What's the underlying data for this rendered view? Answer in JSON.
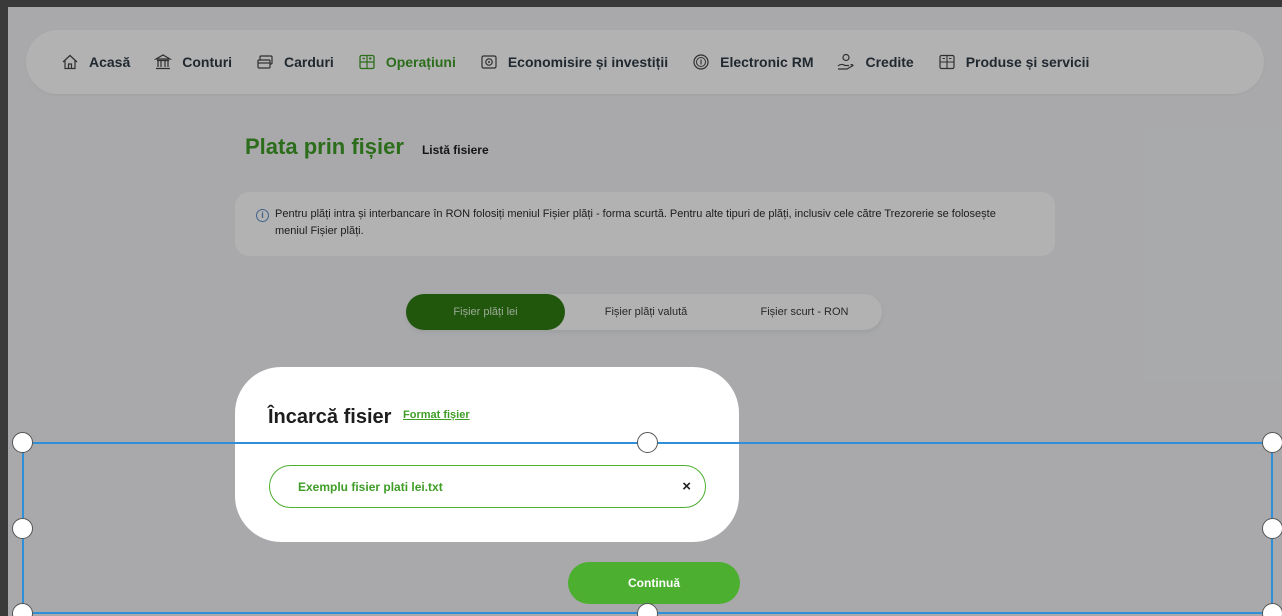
{
  "nav": {
    "items": [
      {
        "label": "Acasă",
        "icon": "home-icon"
      },
      {
        "label": "Conturi",
        "icon": "bank-icon"
      },
      {
        "label": "Carduri",
        "icon": "card-icon"
      },
      {
        "label": "Operațiuni",
        "icon": "operations-icon",
        "active": true
      },
      {
        "label": "Economisire și investiții",
        "icon": "savings-icon"
      },
      {
        "label": "Electronic RM",
        "icon": "coin-icon"
      },
      {
        "label": "Credite",
        "icon": "credit-hand-icon"
      },
      {
        "label": "Produse și servicii",
        "icon": "products-icon"
      }
    ]
  },
  "header": {
    "title": "Plata prin fișier",
    "sub_link": "Listă fisiere"
  },
  "info": {
    "icon": "info-icon",
    "text": "Pentru plăți intra și interbancare în RON folosiți meniul Fișier plăți - forma scurtă. Pentru alte tipuri de plăți, inclusiv cele către Trezorerie se folosește meniul Fișier plăți."
  },
  "tabs": [
    "Fișier plăți lei",
    "Fișier plăți valută",
    "Fișier scurt - RON"
  ],
  "upload": {
    "title": "Încarcă fisier",
    "format_link": "Format fișier",
    "file_name": "Exemplu fisier plati lei.txt",
    "remove_symbol": "×"
  },
  "actions": {
    "continue_label": "Continuă"
  },
  "colors": {
    "accent": "#3f9d27",
    "button": "#4caf30",
    "active_tab": "#2f7d12",
    "selection_border": "#2f8fd8"
  }
}
